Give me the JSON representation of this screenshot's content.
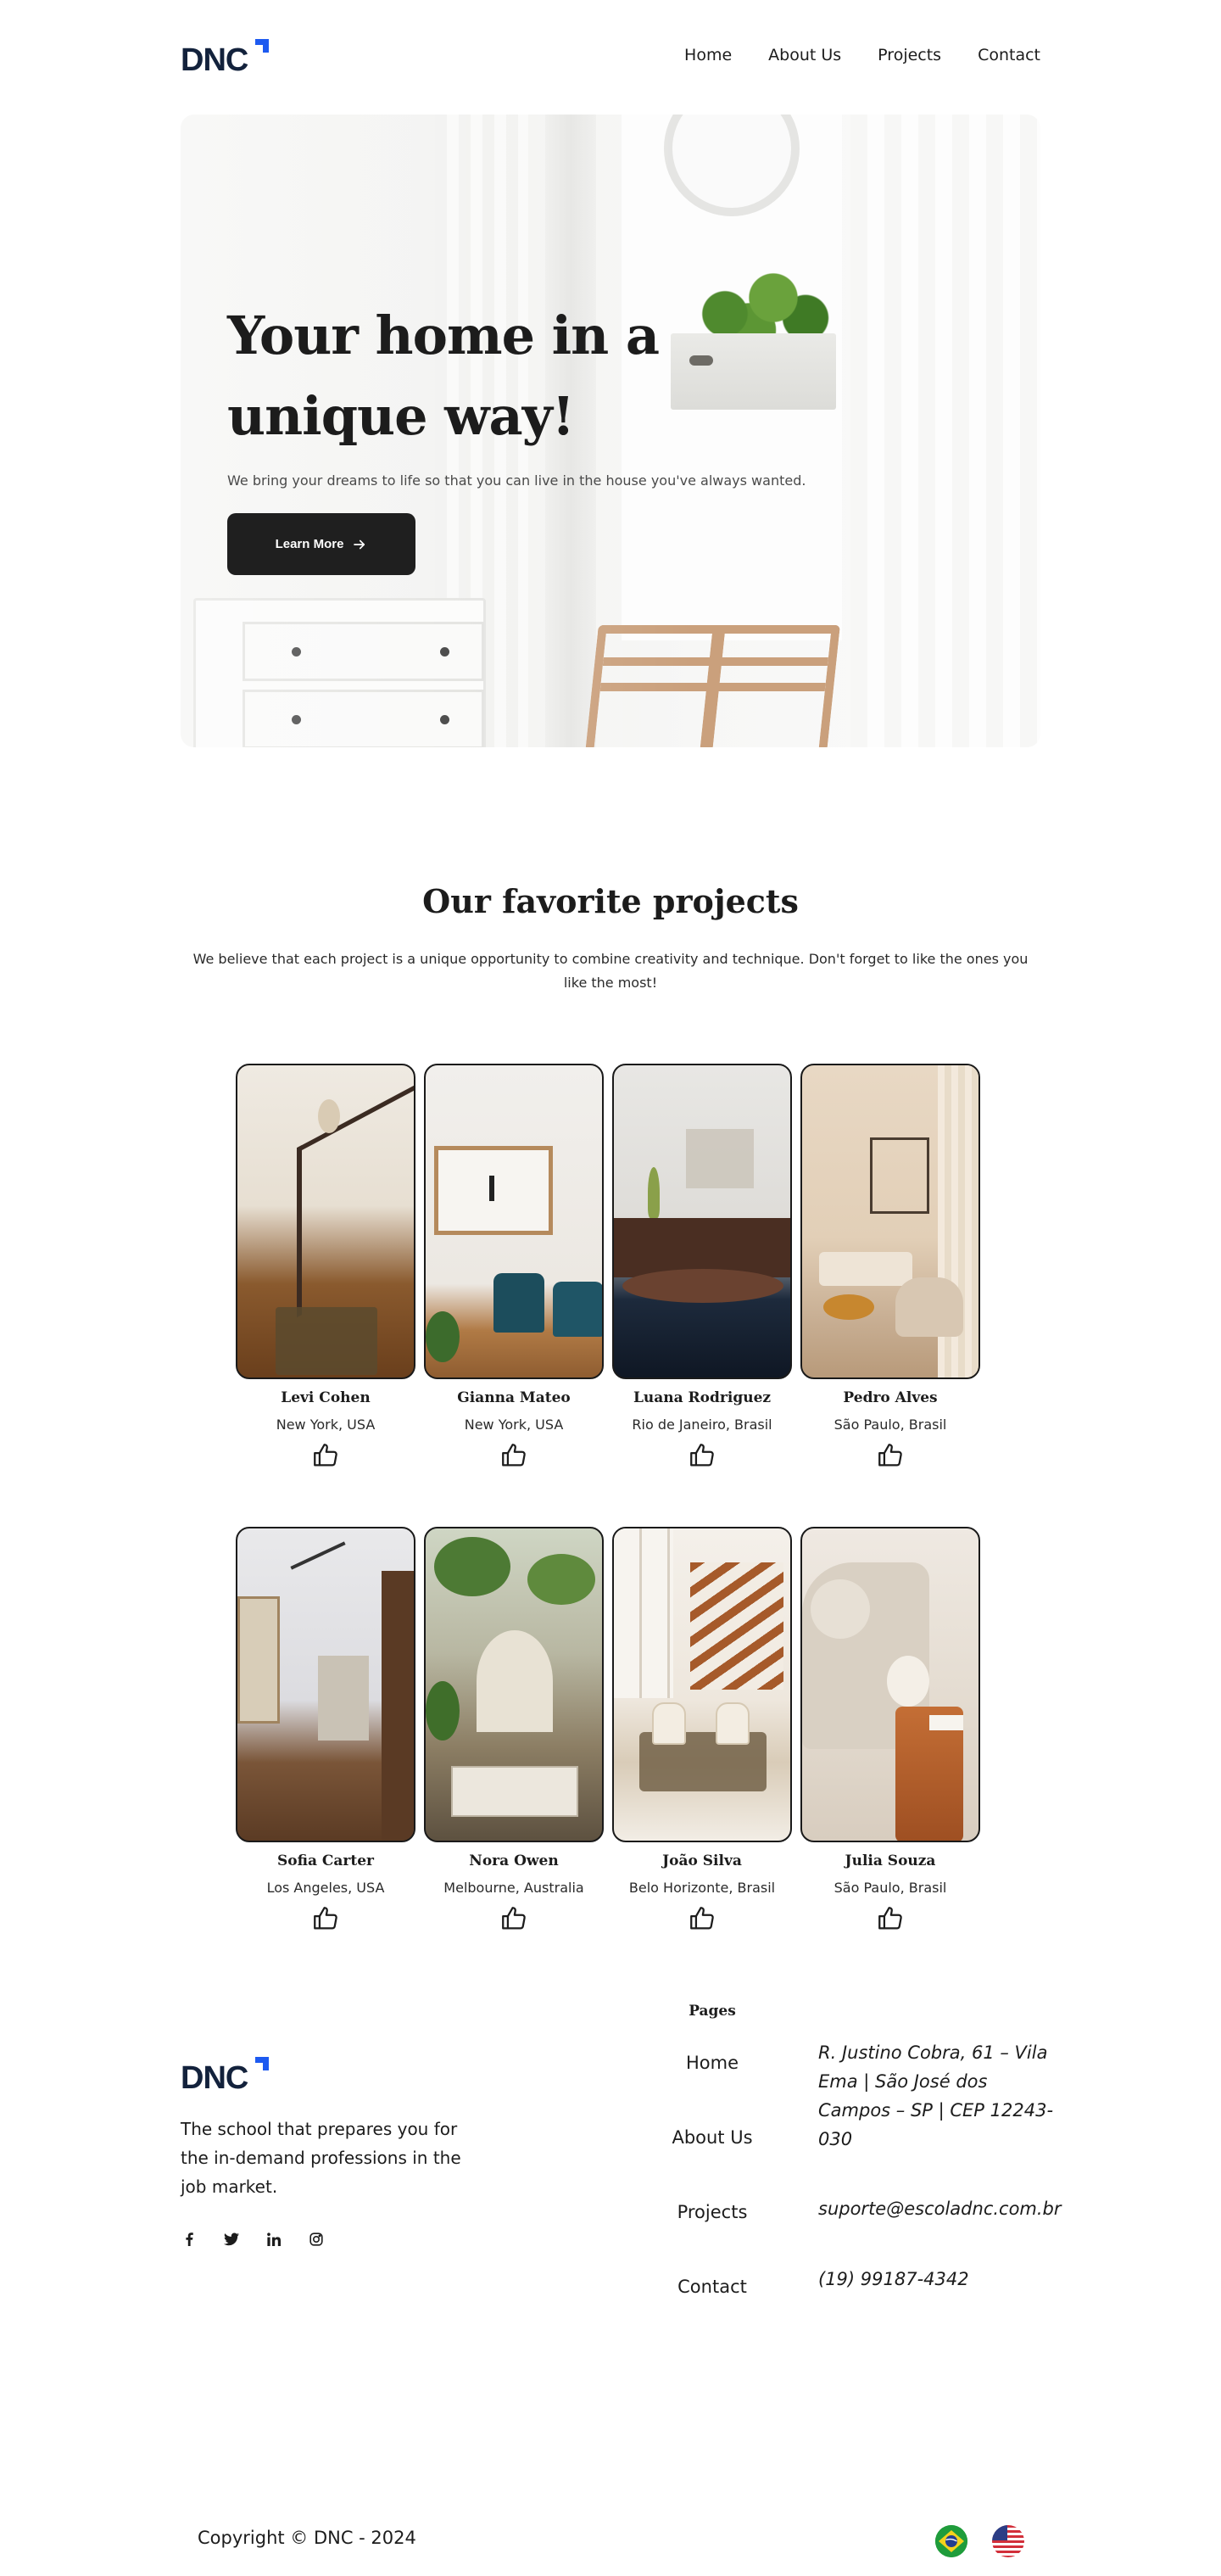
{
  "brand": {
    "logo_text": "DNC",
    "accent": "#1d5af0",
    "dark": "#13223c"
  },
  "nav": {
    "items": [
      "Home",
      "About Us",
      "Projects",
      "Contact"
    ]
  },
  "hero": {
    "title": "Your home in a unique way!",
    "subtitle": "We bring your dreams to life so that you can live in the house you've always wanted.",
    "cta_label": "Learn More",
    "cta_icon": "arrow-right-icon"
  },
  "projects": {
    "title": "Our favorite projects",
    "subtitle": "We believe that each project is a unique opportunity to combine creativity and technique. Don't forget to like the ones you like the most!",
    "items": [
      {
        "name": "Levi Cohen",
        "location": "New York, USA"
      },
      {
        "name": "Gianna Mateo",
        "location": "New York, USA"
      },
      {
        "name": "Luana Rodriguez",
        "location": "Rio de Janeiro, Brasil"
      },
      {
        "name": "Pedro Alves",
        "location": "São Paulo, Brasil"
      },
      {
        "name": "Sofia Carter",
        "location": "Los Angeles, USA"
      },
      {
        "name": "Nora Owen",
        "location": "Melbourne, Australia"
      },
      {
        "name": "João Silva",
        "location": "Belo Horizonte, Brasil"
      },
      {
        "name": "Julia Souza",
        "location": "São Paulo, Brasil"
      }
    ],
    "like_icon": "thumbs-up-icon"
  },
  "footer": {
    "tagline": "The school that prepares you for the in-demand professions in the job market.",
    "social_icons": [
      "facebook-icon",
      "twitter-icon",
      "linkedin-icon",
      "instagram-icon"
    ],
    "pages_title": "Pages",
    "pages": [
      "Home",
      "About Us",
      "Projects",
      "Contact"
    ],
    "address": "R. Justino Cobra, 61 – Vila Ema | São José dos Campos – SP | CEP 12243-030",
    "email": "suporte@escoladnc.com.br",
    "phone": "(19) 99187-4342",
    "copyright": "Copyright © DNC - 2024",
    "language_flags": [
      "brazil-flag-icon",
      "usa-flag-icon"
    ]
  }
}
